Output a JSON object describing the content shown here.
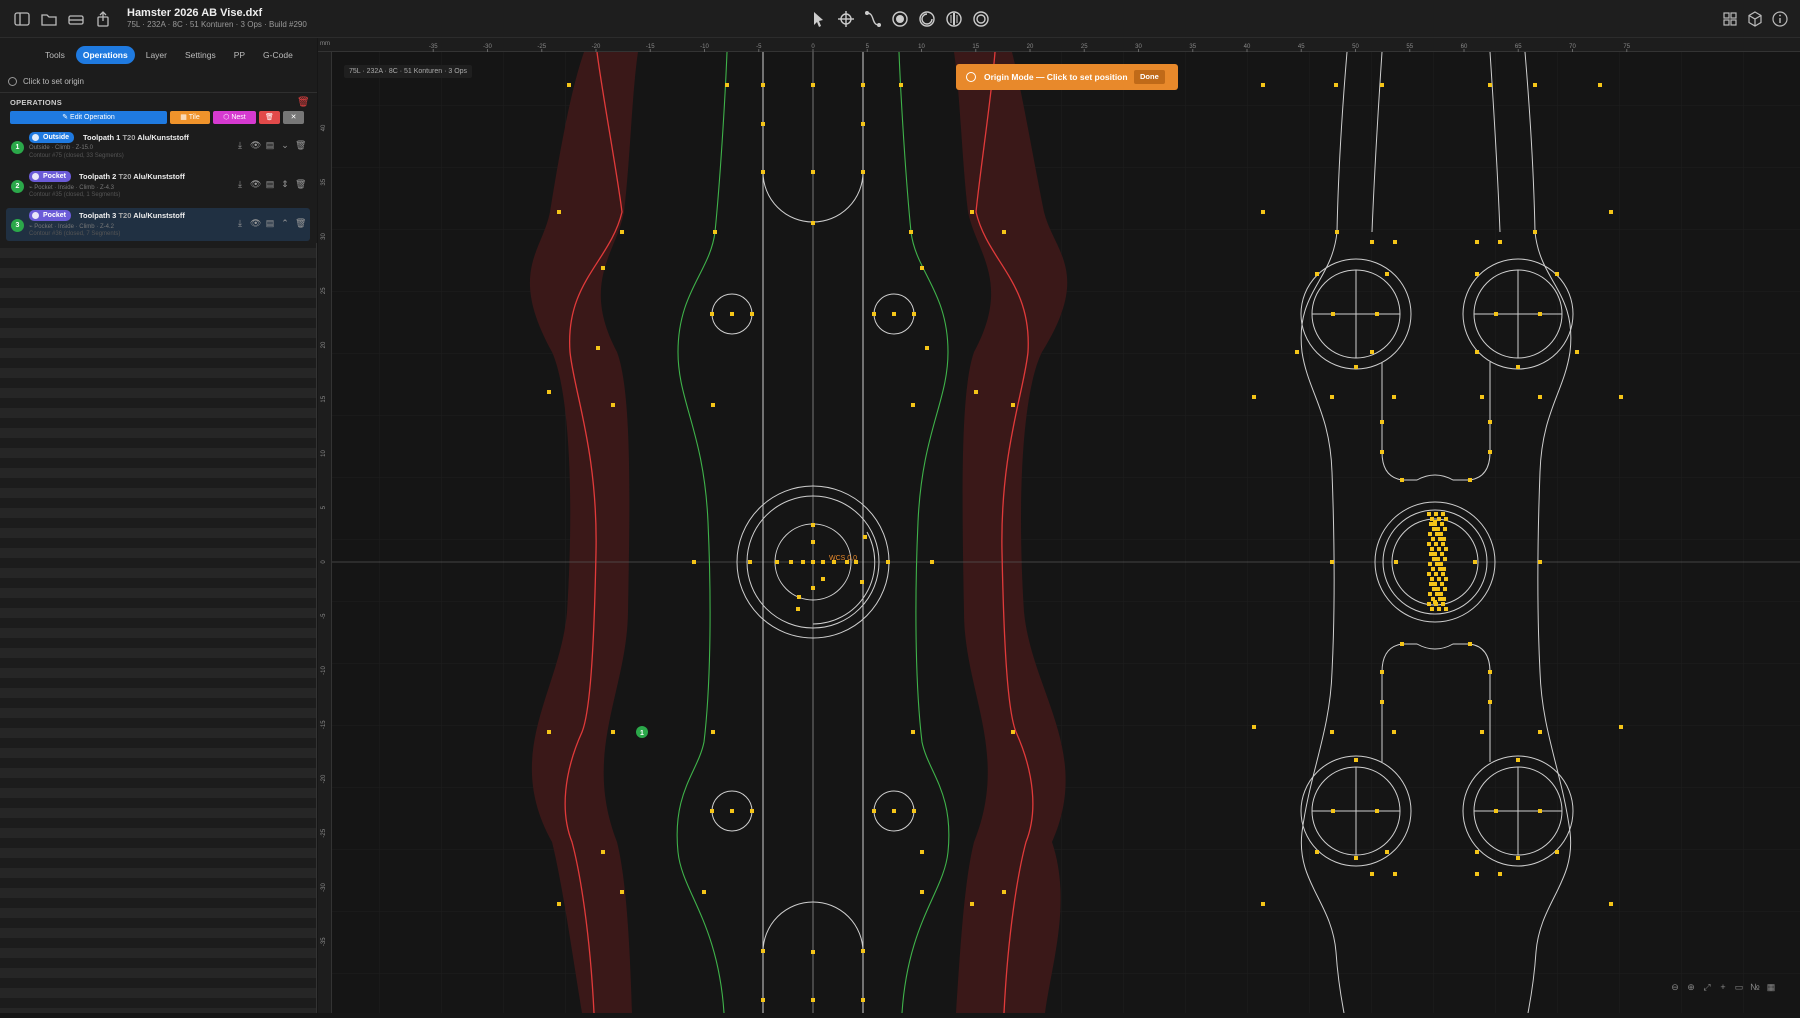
{
  "document": {
    "title": "Hamster 2026 AB Vise.dxf",
    "subtitle": "75L · 232A · 8C · 51 Konturen · 3 Ops · Build #290"
  },
  "titlebar": {
    "left_icons": [
      "sidebar-icon",
      "folder-icon",
      "drive-icon",
      "share-icon"
    ],
    "tools": [
      "pointer-icon",
      "crosshair-icon",
      "path-icon",
      "outside-tool-icon",
      "inside-tool-icon",
      "drill-icon",
      "pocket-tool-icon"
    ],
    "right_icons": [
      "grid-view-icon",
      "cube-icon",
      "info-icon"
    ]
  },
  "sidebar": {
    "tabs": [
      {
        "label": "Tools",
        "active": false
      },
      {
        "label": "Operations",
        "active": true
      },
      {
        "label": "Layer",
        "active": false
      },
      {
        "label": "Settings",
        "active": false
      },
      {
        "label": "PP",
        "active": false
      },
      {
        "label": "G-Code",
        "active": false
      }
    ],
    "origin_hint": "Click to set origin",
    "operations_title": "OPERATIONS",
    "actions": {
      "edit": "✎ Edit Operation",
      "tile": "▦ Tile",
      "nest": "⬡ Nest",
      "delete": "🗑",
      "close": "✕"
    },
    "operations": [
      {
        "num": "1",
        "type": "Outside",
        "name": "Toolpath 1",
        "tool": "T20",
        "material": "Alu/Kunststoff",
        "details": "Outside · Climb · Z-15.0",
        "contour": "Contour #75 (closed, 33 Segments)",
        "selected": false
      },
      {
        "num": "2",
        "type": "Pocket",
        "name": "Toolpath 2",
        "tool": "T20",
        "material": "Alu/Kunststoff",
        "details": "⌁ Pocket · Inside · Climb · Z-4.3",
        "contour": "Contour #35 (closed, 1 Segments)",
        "selected": false
      },
      {
        "num": "3",
        "type": "Pocket",
        "name": "Toolpath 3",
        "tool": "T20",
        "material": "Alu/Kunststoff",
        "details": "⌁ Pocket · Inside · Climb · Z-4.2",
        "contour": "Contour #36 (closed, 7 Segments)",
        "selected": true
      }
    ]
  },
  "canvas": {
    "unit": "mm",
    "info_chip": "75L · 232A · 8C · 51 Konturen · 3 Ops",
    "toast_message": "Origin Mode — Click to set position",
    "toast_done": "Done",
    "wcs_label": "WCS 0,0",
    "toolpath_marker": "1",
    "x_ticks": [
      -35,
      -30,
      -25,
      -20,
      -15,
      -10,
      -5,
      0,
      5,
      10,
      15,
      20,
      25,
      30,
      35,
      40,
      45,
      50,
      55,
      60,
      65,
      70,
      75
    ],
    "y_ticks": [
      40,
      35,
      30,
      25,
      20,
      15,
      10,
      5,
      0,
      -5,
      -10,
      -15,
      -20,
      -25,
      -30,
      -35
    ],
    "colors": {
      "outside_path": "#e03a3a",
      "pocket_path": "#3fb24a",
      "node": "#f5c518",
      "geometry": "#cfcfcf",
      "toast": "#e8892b",
      "accent": "#1f7ae0"
    },
    "zoom_tools": [
      "zoom-out-icon",
      "zoom-in-icon",
      "fit-icon",
      "add-icon",
      "ruler-icon",
      "number-icon",
      "grid-icon"
    ]
  }
}
